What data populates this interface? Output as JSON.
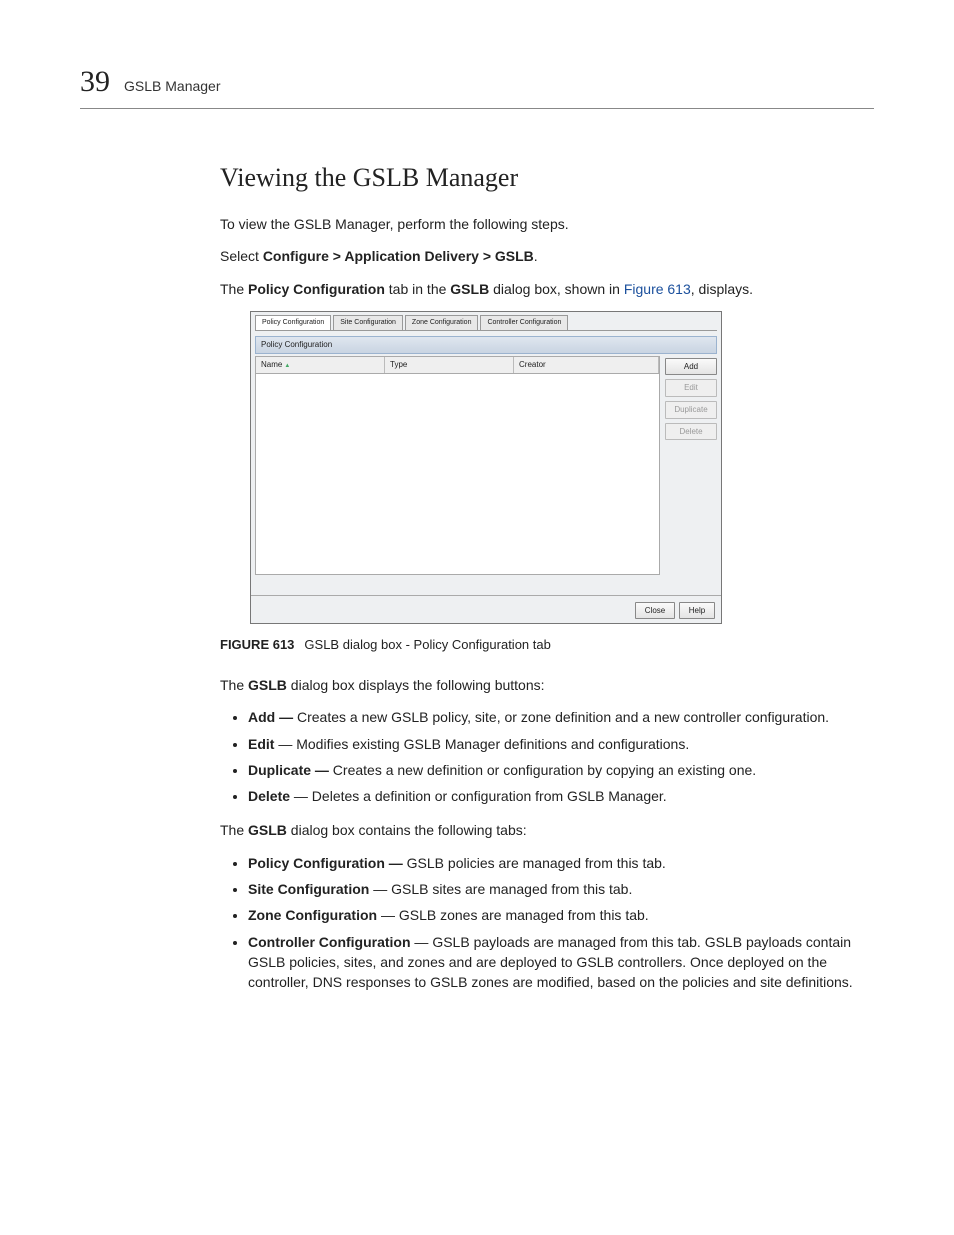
{
  "header": {
    "chapter_number": "39",
    "chapter_label": "GSLB Manager"
  },
  "section": {
    "title": "Viewing the GSLB Manager"
  },
  "intro": {
    "p1": "To view the GSLB Manager, perform the following steps.",
    "p2_pre": "Select ",
    "p2_bold": "Configure > Application Delivery > GSLB",
    "p2_post": ".",
    "p3_a": "The ",
    "p3_b": "Policy Configuration",
    "p3_c": " tab in the ",
    "p3_d": "GSLB",
    "p3_e": " dialog box, shown in ",
    "p3_link": "Figure 613",
    "p3_f": ", displays."
  },
  "dialog": {
    "tabs": [
      "Policy Configuration",
      "Site Configuration",
      "Zone Configuration",
      "Controller Configuration"
    ],
    "section_label": "Policy Configuration",
    "columns": {
      "name": "Name",
      "type": "Type",
      "creator": "Creator"
    },
    "buttons": {
      "add": "Add",
      "edit": "Edit",
      "duplicate": "Duplicate",
      "delete": "Delete"
    },
    "footer": {
      "close": "Close",
      "help": "Help"
    }
  },
  "figure": {
    "label": "FIGURE 613",
    "caption": "GSLB dialog box - Policy Configuration tab"
  },
  "buttons_intro_a": "The ",
  "buttons_intro_b": "GSLB",
  "buttons_intro_c": " dialog box displays the following buttons:",
  "button_list": {
    "add": {
      "name": "Add — ",
      "desc": "Creates a new GSLB policy, site, or zone definition and a new controller configuration."
    },
    "edit": {
      "name": "Edit",
      "desc": " — Modifies existing GSLB Manager definitions and configurations."
    },
    "duplicate": {
      "name": "Duplicate — ",
      "desc": "Creates a new definition or configuration by copying an existing one."
    },
    "delete": {
      "name": "Delete",
      "desc": " — Deletes a definition or configuration from GSLB Manager."
    }
  },
  "tabs_intro_a": "The ",
  "tabs_intro_b": "GSLB",
  "tabs_intro_c": " dialog box contains the following tabs:",
  "tab_list": {
    "policy": {
      "name": "Policy Configuration — ",
      "desc": "GSLB policies are managed from this tab."
    },
    "site": {
      "name": "Site Configuration",
      "desc": " — GSLB sites are managed from this tab."
    },
    "zone": {
      "name": "Zone Configuration",
      "desc": " — GSLB zones are managed from this tab."
    },
    "controller": {
      "name": "Controller Configuration",
      "desc": " — GSLB payloads are managed from this tab. GSLB payloads contain GSLB policies, sites, and zones and are deployed to GSLB controllers. Once deployed on the controller, DNS responses to GSLB zones are modified, based on the policies and site definitions."
    }
  }
}
